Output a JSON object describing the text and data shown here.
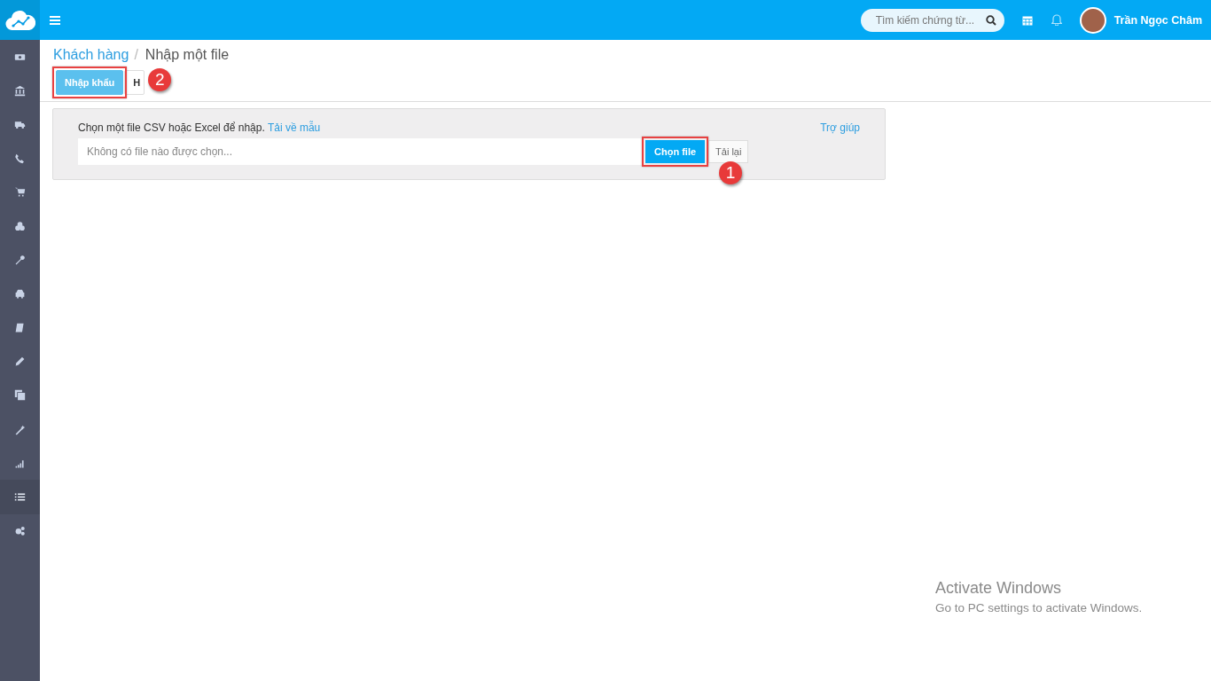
{
  "topbar": {
    "search": {
      "placeholder": "Tìm kiếm chứng từ..."
    },
    "user_name": "Trần Ngọc Châm"
  },
  "sidebar": {
    "items": [
      {
        "selected": false
      },
      {
        "selected": false
      },
      {
        "selected": false
      },
      {
        "selected": false
      },
      {
        "selected": false
      },
      {
        "selected": false
      },
      {
        "selected": false
      },
      {
        "selected": false
      },
      {
        "selected": false
      },
      {
        "selected": false
      },
      {
        "selected": false
      },
      {
        "selected": false
      },
      {
        "selected": false
      },
      {
        "selected": true
      },
      {
        "selected": false
      }
    ]
  },
  "breadcrumb": [
    {
      "label": "Khách hàng",
      "kind": "link"
    },
    {
      "label": "/",
      "kind": "separator"
    },
    {
      "label": "Nhập một file",
      "kind": "current"
    }
  ],
  "tabs": [
    {
      "label": "Nhập khẩu",
      "selected": true,
      "annotation": "2"
    },
    {
      "label": "H",
      "selected": false
    }
  ],
  "import_panel": {
    "instruction": "Chọn một file CSV hoặc Excel để nhập.",
    "template_link": "Tải về mẫu",
    "help_link": "Trợ giúp",
    "file_field": {
      "placeholder": "Không có file nào được chọn..."
    },
    "choose_button": {
      "label": "Chọn file",
      "annotation": "1"
    },
    "reload_button": "Tải lại"
  },
  "os_notice": {
    "title": "Activate Windows",
    "subtitle": "Go to PC settings to activate Windows."
  }
}
